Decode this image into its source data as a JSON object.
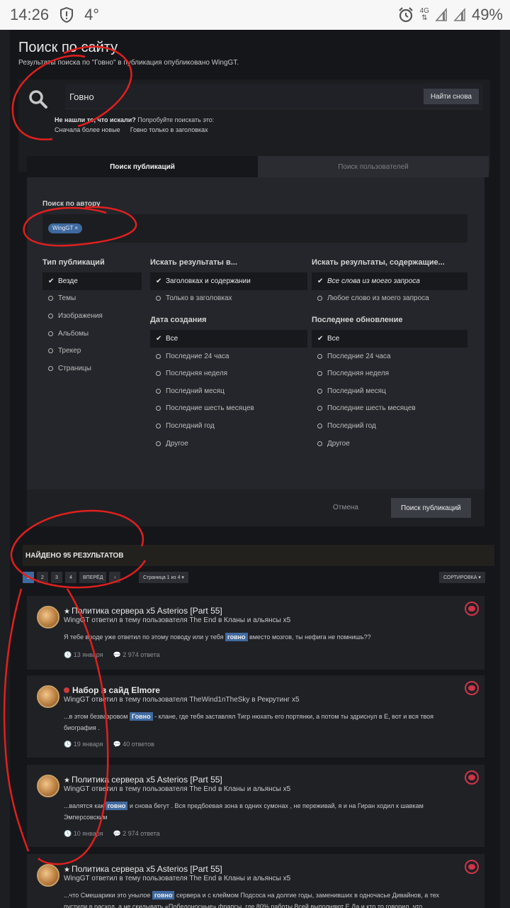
{
  "status": {
    "time": "14:26",
    "temp": "4°",
    "network": "4G",
    "battery": "49%"
  },
  "header": {
    "title": "Поиск по сайту",
    "subtitle": "Результаты поиска по \"Говно\" в публикация опубликовано WingGT."
  },
  "search": {
    "value": "Говно",
    "again_label": "Найти снова",
    "not_found_bold": "Не нашли то, что искали?",
    "not_found_rest": " Попробуйте поискать это:",
    "suggestion_newest": "Сначала более новые",
    "suggestion_titles": "Говно только в заголовках"
  },
  "tabs": {
    "posts": "Поиск публикаций",
    "users": "Поиск пользователей"
  },
  "filters": {
    "author_label": "Поиск по автору",
    "author_tag": "WingGT ×",
    "type_title": "Тип публикаций",
    "type_options": [
      "Везде",
      "Темы",
      "Изображения",
      "Альбомы",
      "Трекер",
      "Страницы"
    ],
    "in_title": "Искать результаты в...",
    "in_options": [
      "Заголовках и содержании",
      "Только в заголовках"
    ],
    "contains_title": "Искать результаты, содержащие...",
    "contains_options": [
      "Все слова из моего запроса",
      "Любое слово из моего запроса"
    ],
    "created_title": "Дата создания",
    "updated_title": "Последнее обновление",
    "date_options": [
      "Все",
      "Последние 24 часа",
      "Последняя неделя",
      "Последний месяц",
      "Последние шесть месяцев",
      "Последний год",
      "Другое"
    ],
    "cancel": "Отмена",
    "submit": "Поиск публикаций"
  },
  "results": {
    "header": "НАЙДЕНО 95 РЕЗУЛЬТАТОВ",
    "pages": [
      "1",
      "2",
      "3",
      "4"
    ],
    "next": "ВПЕРЁД",
    "page_select": "Страница 1 из 4 ▾",
    "sort": "СОРТИРОВКА ▾"
  },
  "cards": [
    {
      "title": "Политика сервера x5 Asterios [Part 55]",
      "sub": "WingGT ответил в тему пользователя The End в Кланы и альянсы x5",
      "pre": "Я тебе вроде уже ответил по этому поводу или у тебя ",
      "hl": "говно",
      "post": " вместо мозгов, ты нефига не помнишь??",
      "date": "13 января",
      "replies": "2 974 ответа"
    },
    {
      "title": "Набор в сайд Elmore",
      "sub": "WingGT ответил в тему пользователя TheWind1nTheSky в Рекрутинг x5",
      "pre": "...в этом безвазровом ",
      "hl": "Говно",
      "post": " - клане, где тебя заставлял Тигр нюхать его портянки, а потом ты здриснул в Е, вот и вся твоя биография .",
      "date": "19 января",
      "replies": "40 ответов"
    },
    {
      "title": "Политика сервера x5 Asterios [Part 55]",
      "sub": "WingGT ответил в тему пользователя The End в Кланы и альянсы x5",
      "pre": "...валятся как ",
      "hl": "говно",
      "post": " и снова бегут . Вся предбоевая зона в одних сумонах , не переживай, я и на Гиран ходил к шавкам Эмперсовским",
      "date": "10 января",
      "replies": "2 974 ответа"
    },
    {
      "title": "Политика сервера x5 Asterios [Part 55]",
      "sub": "WingGT ответил в тему пользователя The End в Кланы и альянсы x5",
      "pre": "...что Смешарики это унылое ",
      "hl": "говно",
      "post": " сервера и с клеймом Подсоса на долгие годы, заменивших в одночасье Дивайнов, а тех пустили в расход, а не скидывать «Победоносные» фрапсы, где 80% работы Всей выполняют Е Да и кто то говорил, что",
      "date": "",
      "replies": ""
    }
  ]
}
